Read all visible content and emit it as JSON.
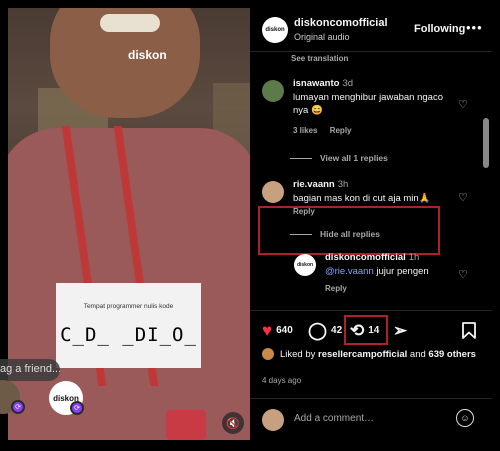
{
  "video": {
    "watermark": "diskon",
    "card_caption": "Tempat programmer nulis kode",
    "card_text": "C_D_ _DI_O_",
    "tag_input_placeholder": "ag a friend..."
  },
  "header": {
    "account_name": "diskoncomofficial",
    "audio_label": "Original audio",
    "follow_label": "Following",
    "more_icon": "more-icon"
  },
  "comments": {
    "see_translation": "See translation",
    "items": [
      {
        "user": "isnawanto",
        "time": "3d",
        "text": "lumayan menghibur jawaban ngaco nya 😄",
        "likes": "3 likes",
        "reply": "Reply"
      },
      {
        "user": "rie.vaann",
        "time": "3h",
        "text": "bagian mas kon di cut aja min🙏",
        "reply": "Reply"
      }
    ],
    "view_replies": "View all 1 replies",
    "hide_replies": "Hide all replies",
    "reply_item": {
      "user": "diskoncomofficial",
      "time": "1h",
      "mention": "@rie.vaann",
      "text": "jujur pengen",
      "reply": "Reply"
    }
  },
  "actions": {
    "likes_count": "640",
    "comments_count": "42",
    "reposts_count": "14"
  },
  "liked_by": {
    "prefix": "Liked by",
    "user": "resellercampofficial",
    "and": "and",
    "others": "639 others"
  },
  "posted_ago": "4 days ago",
  "add_comment": {
    "placeholder": "Add a comment…"
  },
  "colors": {
    "highlight": "#b0202a",
    "like": "#ff3040",
    "mention": "#7fa8ff"
  }
}
